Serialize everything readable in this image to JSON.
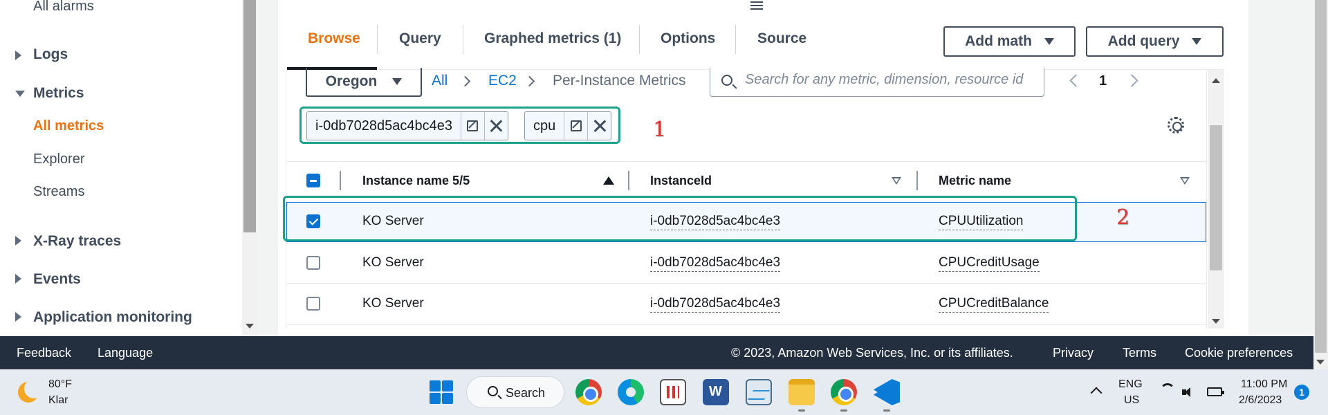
{
  "sidebar": {
    "items": [
      {
        "label": "All alarms"
      },
      {
        "label": "Logs"
      },
      {
        "label": "Metrics"
      },
      {
        "label": "All metrics"
      },
      {
        "label": "Explorer"
      },
      {
        "label": "Streams"
      },
      {
        "label": "X-Ray traces"
      },
      {
        "label": "Events"
      },
      {
        "label": "Application monitoring"
      }
    ]
  },
  "tabs": [
    {
      "label": "Browse",
      "active": true
    },
    {
      "label": "Query"
    },
    {
      "label": "Graphed metrics (1)"
    },
    {
      "label": "Options"
    },
    {
      "label": "Source"
    }
  ],
  "actions": {
    "add_math": "Add math",
    "add_query": "Add query"
  },
  "browse": {
    "region": "Oregon",
    "breadcrumb": [
      "All",
      "EC2",
      "Per-Instance Metrics"
    ],
    "search_placeholder": "Search for any metric, dimension, resource id",
    "page": "1"
  },
  "filters": [
    {
      "label": "i-0db7028d5ac4bc4e3"
    },
    {
      "label": "cpu"
    }
  ],
  "annotations": [
    "1",
    "2"
  ],
  "table": {
    "columns": [
      "Instance name 5/5",
      "InstanceId",
      "Metric name"
    ],
    "rows": [
      {
        "instance_name": "KO Server",
        "instance_id": "i-0db7028d5ac4bc4e3",
        "metric": "CPUUtilization",
        "checked": true
      },
      {
        "instance_name": "KO Server",
        "instance_id": "i-0db7028d5ac4bc4e3",
        "metric": "CPUCreditUsage",
        "checked": false
      },
      {
        "instance_name": "KO Server",
        "instance_id": "i-0db7028d5ac4bc4e3",
        "metric": "CPUCreditBalance",
        "checked": false
      }
    ]
  },
  "footer": {
    "feedback": "Feedback",
    "language": "Language",
    "copyright": "© 2023, Amazon Web Services, Inc. or its affiliates.",
    "privacy": "Privacy",
    "terms": "Terms",
    "cookies": "Cookie preferences"
  },
  "taskbar": {
    "weather_temp": "80°F",
    "weather_desc": "Klar",
    "search_label": "Search",
    "lang_primary": "ENG",
    "lang_secondary": "US",
    "time": "11:00 PM",
    "date": "2/6/2023",
    "notification_count": "1",
    "apps": [
      "chrome-icon",
      "edge-icon",
      "tasks-icon",
      "word-icon",
      "performance-icon",
      "file-explorer-icon",
      "chrome-profile-icon",
      "vscode-icon"
    ]
  },
  "colors": {
    "accent": "#ec7211",
    "link": "#0972d3",
    "annotation_box": "#1aa38a",
    "annotation_number": "#e03131",
    "footer_bg": "#232f3e"
  }
}
